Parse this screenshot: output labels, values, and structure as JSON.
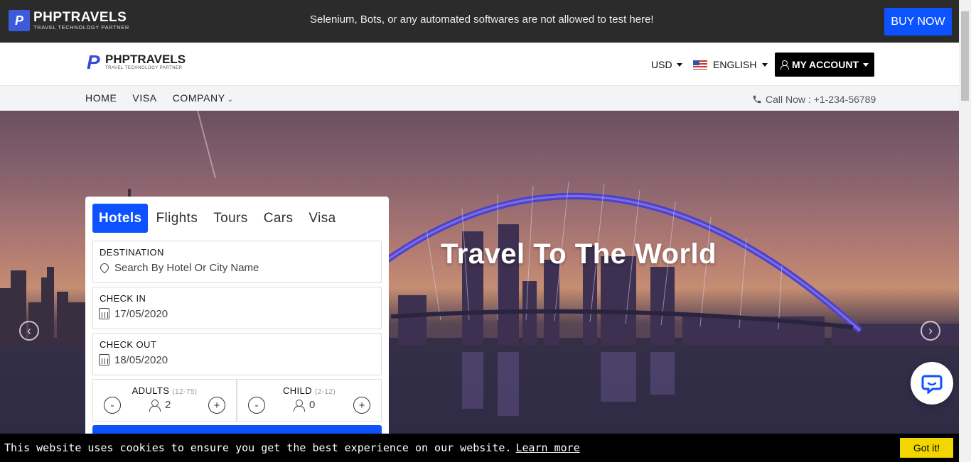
{
  "topbar": {
    "brand_name": "PHPTRAVELS",
    "brand_tagline": "TRAVEL TECHNOLOGY PARTNER",
    "notice": "Selenium, Bots, or any automated softwares are not allowed to test here!",
    "buy_label": "BUY NOW"
  },
  "header": {
    "logo_name": "PHPTRAVELS",
    "logo_tagline": "TRAVEL TECHNOLOGY PARTNER",
    "currency": "USD",
    "language": "ENGLISH",
    "account_label": "MY ACCOUNT"
  },
  "nav": {
    "items": [
      "HOME",
      "VISA",
      "COMPANY"
    ],
    "call_text": "Call Now : +1-234-56789"
  },
  "hero": {
    "headline": "Travel To The World"
  },
  "search": {
    "tabs": [
      "Hotels",
      "Flights",
      "Tours",
      "Cars",
      "Visa"
    ],
    "active_tab": "Hotels",
    "destination_label": "DESTINATION",
    "destination_placeholder": "Search By Hotel Or City Name",
    "checkin_label": "CHECK IN",
    "checkin_value": "17/05/2020",
    "checkout_label": "CHECK OUT",
    "checkout_value": "18/05/2020",
    "adults_label": "ADULTS",
    "adults_range": "(12-75)",
    "adults_value": "2",
    "child_label": "CHILD",
    "child_range": "(2-12)",
    "child_value": "0",
    "minus": "-",
    "plus": "+"
  },
  "cookie": {
    "message": "This website uses cookies to ensure you get the best experience on our website.",
    "learn_more": "Learn more",
    "accept": "Got it!"
  },
  "colors": {
    "primary": "#0d52ff",
    "topbar_bg": "#2b2b2b",
    "cookie_button": "#f1d600"
  },
  "icons": {
    "prev": "chevron-left-icon",
    "next": "chevron-right-icon",
    "chat": "chat-bubble-icon"
  }
}
